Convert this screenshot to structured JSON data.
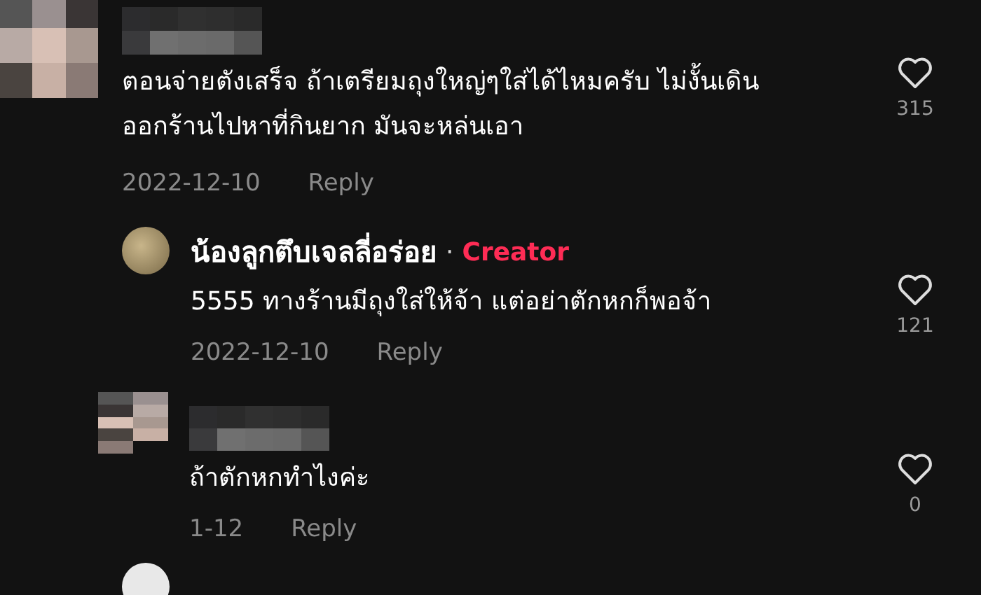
{
  "comments": [
    {
      "kind": "top",
      "author": {
        "blurred": true
      },
      "text": "ตอนจ่ายตังเสร็จ ถ้าเตรียมถุงใหญ่ๆใส่ได้ไหมครับ ไม่งั้นเดิน ออกร้านไปหาที่กินยาก มันจะหล่นเอา",
      "date": "2022-12-10",
      "reply": "Reply",
      "likes": "315"
    },
    {
      "kind": "reply",
      "author": {
        "blurred": false,
        "name": "น้องลูกตึบเจลลี่อร่อย",
        "separator": "·",
        "badge": "Creator"
      },
      "text": "5555 ทางร้านมีถุงใส่ให้จ้า แต่อย่าตักหกก็พอจ้า",
      "date": "2022-12-10",
      "reply": "Reply",
      "likes": "121"
    },
    {
      "kind": "reply",
      "author": {
        "blurred": true
      },
      "text": "ถ้าตักหกทำไงค่ะ",
      "date": "1-12",
      "reply": "Reply",
      "likes": "0"
    }
  ]
}
